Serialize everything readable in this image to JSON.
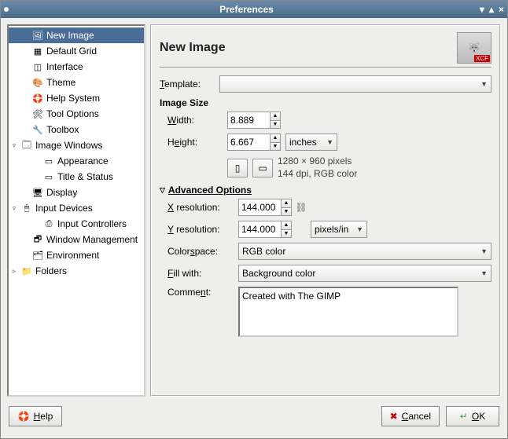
{
  "window": {
    "title": "Preferences"
  },
  "sidebar": {
    "items": [
      {
        "label": "New Image",
        "indent": 1,
        "arrow": "",
        "selected": true,
        "icon": "🖼"
      },
      {
        "label": "Default Grid",
        "indent": 1,
        "arrow": "",
        "icon": "▦"
      },
      {
        "label": "Interface",
        "indent": 1,
        "arrow": "",
        "icon": "◫"
      },
      {
        "label": "Theme",
        "indent": 1,
        "arrow": "",
        "icon": "🎨"
      },
      {
        "label": "Help System",
        "indent": 1,
        "arrow": "",
        "icon": "🛟"
      },
      {
        "label": "Tool Options",
        "indent": 1,
        "arrow": "",
        "icon": "🛠"
      },
      {
        "label": "Toolbox",
        "indent": 1,
        "arrow": "",
        "icon": "🔧"
      },
      {
        "label": "Image Windows",
        "indent": 0,
        "arrow": "▿",
        "icon": "🗔"
      },
      {
        "label": "Appearance",
        "indent": 2,
        "arrow": "",
        "icon": "▭"
      },
      {
        "label": "Title & Status",
        "indent": 2,
        "arrow": "",
        "icon": "▭"
      },
      {
        "label": "Display",
        "indent": 1,
        "arrow": "",
        "icon": "🖥"
      },
      {
        "label": "Input Devices",
        "indent": 0,
        "arrow": "▿",
        "icon": "🖱"
      },
      {
        "label": "Input Controllers",
        "indent": 2,
        "arrow": "",
        "icon": "⎙"
      },
      {
        "label": "Window Management",
        "indent": 1,
        "arrow": "",
        "icon": "🗗"
      },
      {
        "label": "Environment",
        "indent": 1,
        "arrow": "",
        "icon": "🗂"
      },
      {
        "label": "Folders",
        "indent": 0,
        "arrow": "▹",
        "icon": "📁"
      }
    ]
  },
  "page": {
    "title": "New Image",
    "template_label": "Template:",
    "template_value": "",
    "image_size_label": "Image Size",
    "width_label": "Width:",
    "width_value": "8.889",
    "height_label": "Height:",
    "height_value": "6.667",
    "unit_value": "inches",
    "info_line1": "1280 × 960 pixels",
    "info_line2": "144 dpi, RGB color",
    "advanced_label": "Advanced Options",
    "xres_label": "X resolution:",
    "xres_value": "144.000",
    "yres_label": "Y resolution:",
    "yres_value": "144.000",
    "res_unit": "pixels/in",
    "colorspace_label": "Colorspace:",
    "colorspace_value": "RGB color",
    "fill_label": "Fill with:",
    "fill_value": "Background color",
    "comment_label": "Comment:",
    "comment_value": "Created with The GIMP"
  },
  "footer": {
    "help": "Help",
    "cancel": "Cancel",
    "ok": "OK"
  }
}
